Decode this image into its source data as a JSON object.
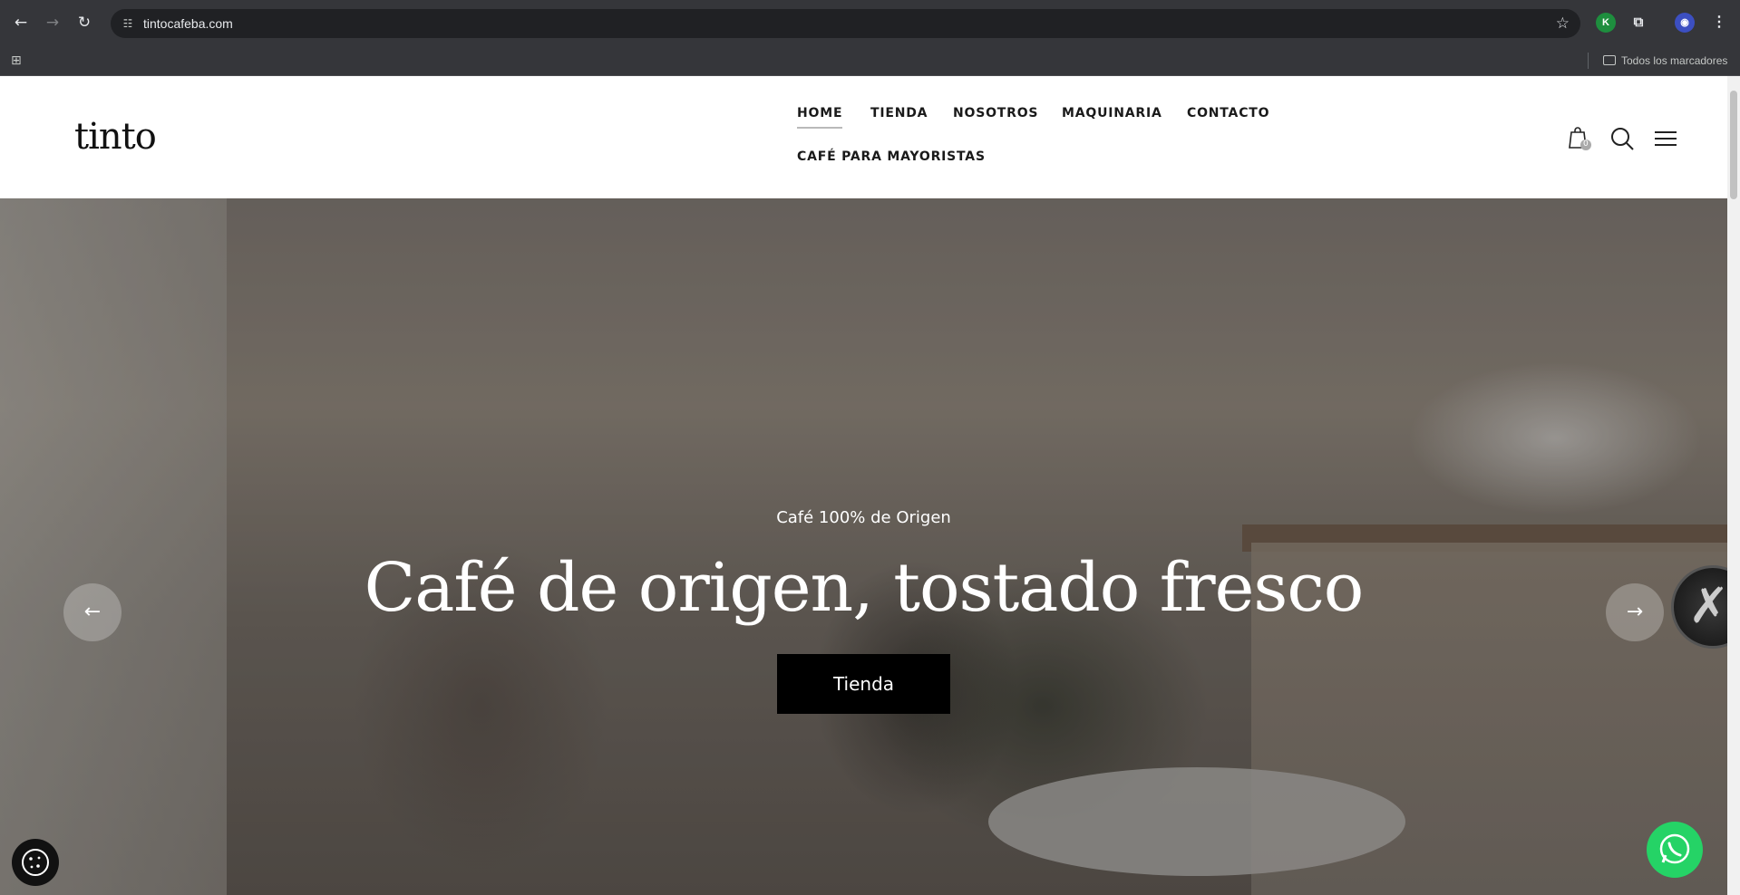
{
  "browser": {
    "url": "tintocafeba.com",
    "bookmarks_folder": "Todos los marcadores",
    "icons": [
      "back-icon",
      "forward-icon",
      "reload-icon",
      "site-info-icon",
      "bookmark-star-icon",
      "extensions-icon",
      "menu-icon"
    ]
  },
  "site": {
    "logo": "tinto",
    "menu": [
      "HOME",
      "TIENDA",
      "NOSOTROS",
      "MAQUINARIA",
      "CONTACTO",
      "CAFÉ PARA MAYORISTAS"
    ],
    "active_menu_item": "HOME",
    "cart_count": "0",
    "header_icons": [
      "cart-icon",
      "search-icon",
      "hamburger-icon"
    ]
  },
  "hero": {
    "subtitle": "Café 100% de Origen",
    "headline": "Café de origen, tostado fresco",
    "cta": "Tienda"
  },
  "colors": {
    "accent": "#000000",
    "whatsapp": "#25d366",
    "menu_text": "#1a1a1a"
  }
}
